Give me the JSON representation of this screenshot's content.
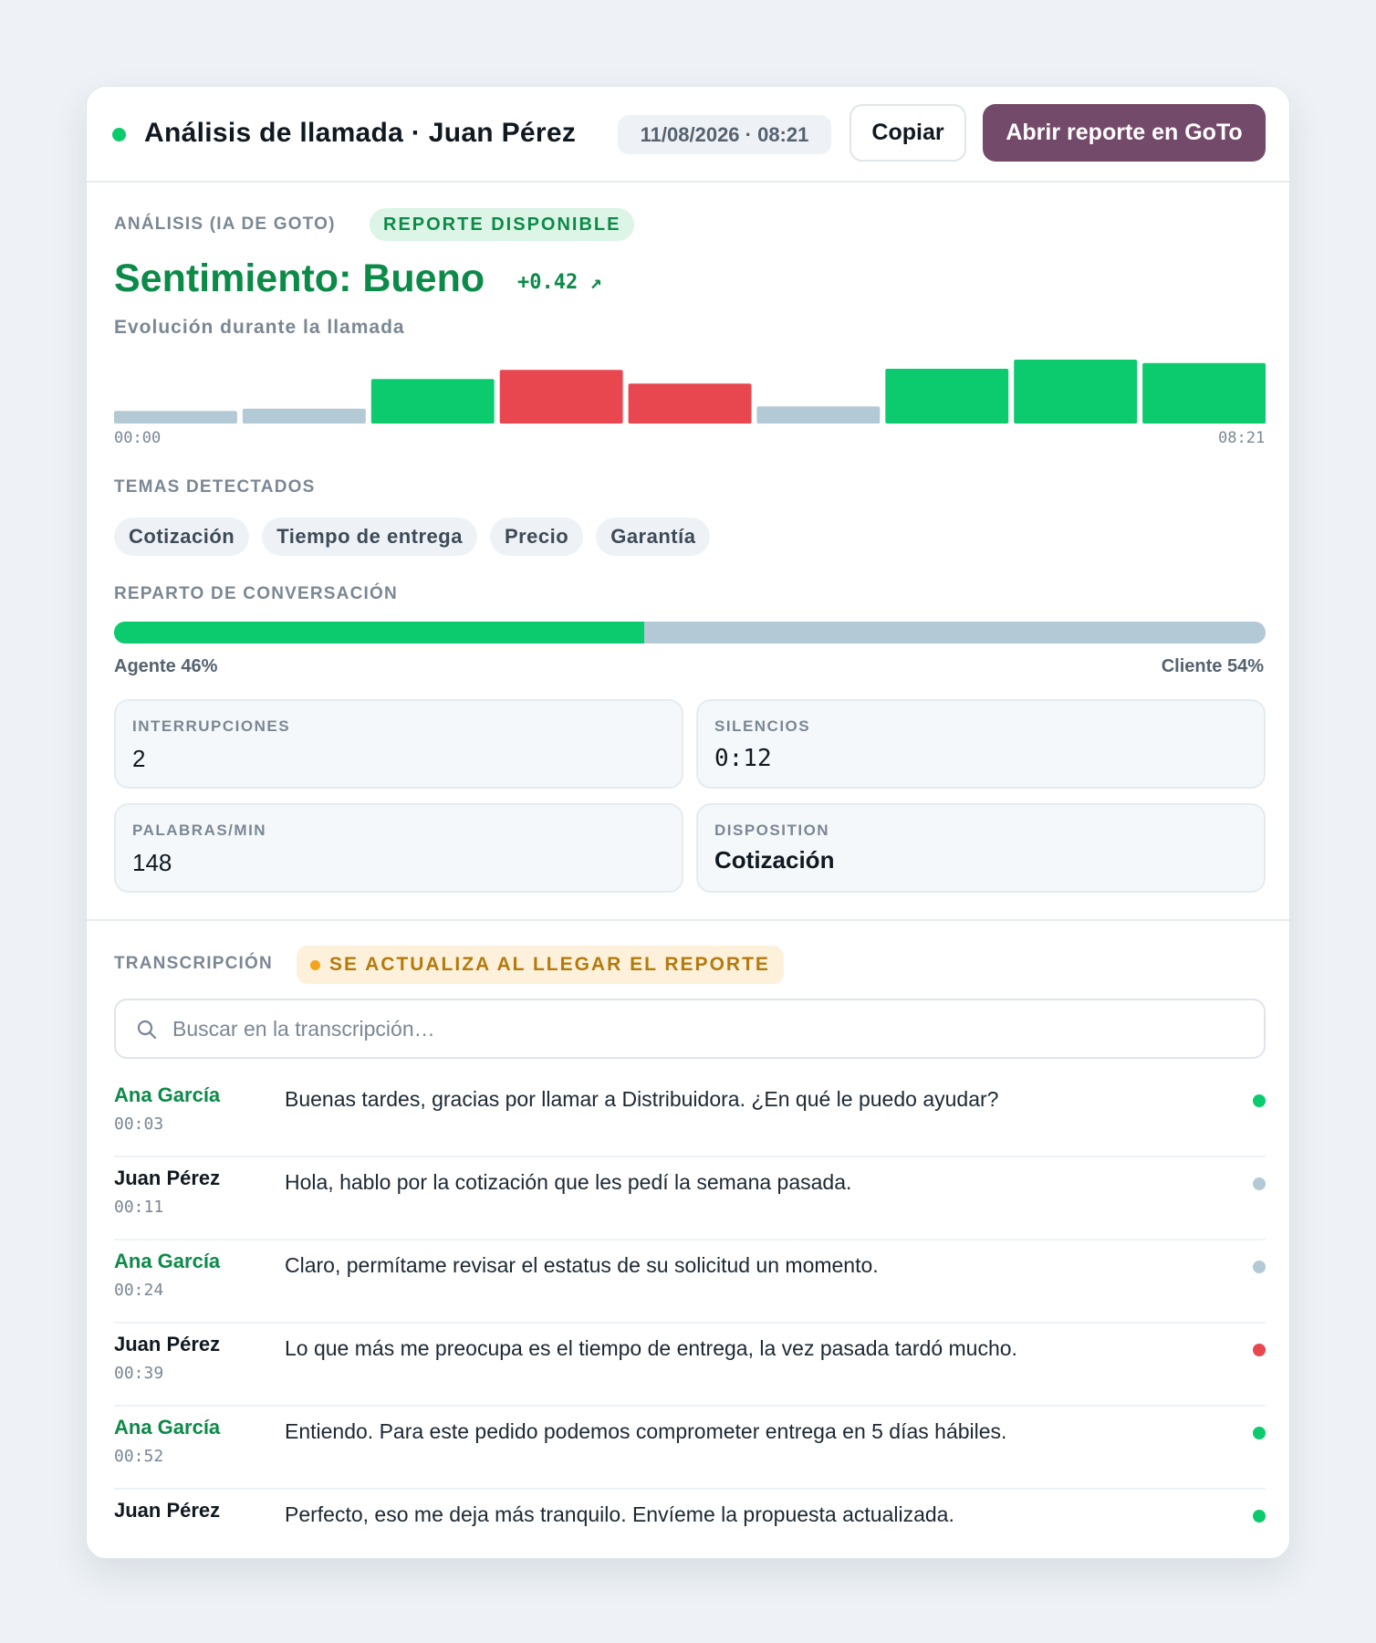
{
  "header": {
    "title": "Análisis de llamada · Juan Pérez",
    "datetime": "11/08/2026 · 08:21",
    "copy_label": "Copiar",
    "open_report_label": "Abrir reporte en GoTo",
    "status": "live"
  },
  "analysis": {
    "section_label": "ANÁLISIS (IA DE GOTO)",
    "report_badge": "REPORTE DISPONIBLE",
    "sentiment_text": "Sentimiento: Bueno",
    "score_text": "+0.42 ↗",
    "evolution_label": "Evolución durante la llamada",
    "time_start": "00:00",
    "time_end": "08:21"
  },
  "chart_data": {
    "type": "bar",
    "segments": [
      {
        "score": 0.11,
        "sentiment": "neutral"
      },
      {
        "score": 0.13,
        "sentiment": "neutral"
      },
      {
        "score": 0.39,
        "sentiment": "positive"
      },
      {
        "score": -0.47,
        "sentiment": "negative"
      },
      {
        "score": -0.35,
        "sentiment": "negative"
      },
      {
        "score": 0.15,
        "sentiment": "neutral"
      },
      {
        "score": 0.48,
        "sentiment": "positive"
      },
      {
        "score": 0.56,
        "sentiment": "positive"
      },
      {
        "score": 0.53,
        "sentiment": "positive"
      }
    ],
    "x_range": [
      "00:00",
      "08:21"
    ],
    "value_range": [
      0,
      0.6
    ]
  },
  "topics": {
    "label": "TEMAS DETECTADOS",
    "items": [
      "Cotización",
      "Tiempo de entrega",
      "Precio",
      "Garantía"
    ]
  },
  "conversation_split": {
    "label": "REPARTO DE CONVERSACIÓN",
    "agent_pct": 46,
    "client_pct": 54,
    "agent_label": "Agente 46%",
    "client_label": "Cliente 54%"
  },
  "metrics": {
    "interruptions_label": "INTERRUPCIONES",
    "interruptions_value": "2",
    "silences_label": "SILENCIOS",
    "silences_value": "0:12",
    "wpm_label": "PALABRAS/MIN",
    "wpm_value": "148",
    "disposition_label": "DISPOSITION",
    "disposition_value": "Cotización"
  },
  "transcript": {
    "label": "TRANSCRIPCIÓN",
    "update_badge": "SE ACTUALIZA AL LLEGAR EL REPORTE",
    "search_placeholder": "Buscar en la transcripción…",
    "rows": [
      {
        "speaker": "Ana García",
        "role": "agent",
        "time": "00:03",
        "text": "Buenas tardes, gracias por llamar a Distribuidora. ¿En qué le puedo ayudar?",
        "sentiment": "positive"
      },
      {
        "speaker": "Juan Pérez",
        "role": "client",
        "time": "00:11",
        "text": "Hola, hablo por la cotización que les pedí la semana pasada.",
        "sentiment": "neutral"
      },
      {
        "speaker": "Ana García",
        "role": "agent",
        "time": "00:24",
        "text": "Claro, permítame revisar el estatus de su solicitud un momento.",
        "sentiment": "neutral"
      },
      {
        "speaker": "Juan Pérez",
        "role": "client",
        "time": "00:39",
        "text": "Lo que más me preocupa es el tiempo de entrega, la vez pasada tardó mucho.",
        "sentiment": "negative"
      },
      {
        "speaker": "Ana García",
        "role": "agent",
        "time": "00:52",
        "text": "Entiendo. Para este pedido podemos comprometer entrega en 5 días hábiles.",
        "sentiment": "positive"
      },
      {
        "speaker": "Juan Pérez",
        "role": "client",
        "time": "",
        "text": "Perfecto, eso me deja más tranquilo. Envíeme la propuesta actualizada.",
        "sentiment": "positive"
      }
    ]
  },
  "colors": {
    "positive": "#0ccb6e",
    "negative": "#e8474f",
    "neutral": "#b3c9d6",
    "agent_name": "#0c8a48",
    "client_name": "#101820",
    "brand_button": "#744a6b",
    "accent_text": "#0c8a48"
  },
  "icons": {
    "search": "search-icon",
    "trend": "arrow-up-right-icon",
    "status": "live-status-dot"
  }
}
